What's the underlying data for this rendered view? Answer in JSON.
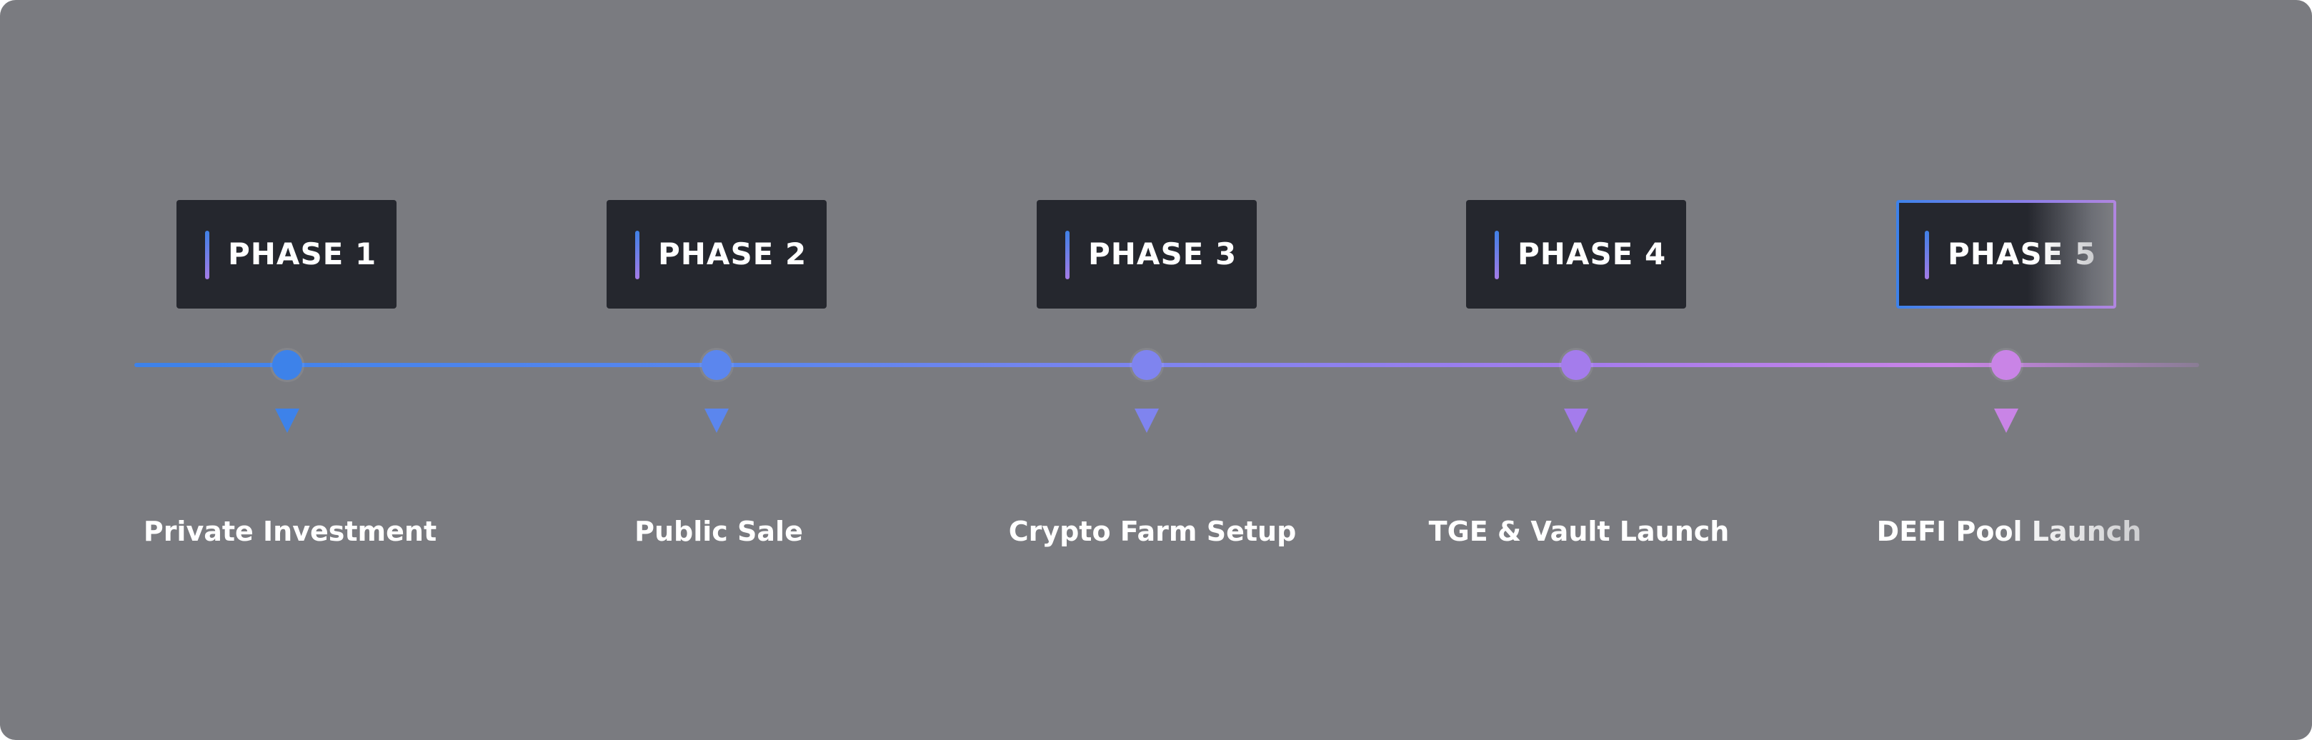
{
  "roadmap": {
    "phases": [
      {
        "label": "PHASE 1",
        "name": "Private Investment",
        "color": "#3d82ea"
      },
      {
        "label": "PHASE 2",
        "name": "Public Sale",
        "color": "#5b86ee"
      },
      {
        "label": "PHASE 3",
        "name": "Crypto Farm Setup",
        "color": "#7f84ef"
      },
      {
        "label": "PHASE 4",
        "name": "TGE & Vault Launch",
        "color": "#a47cec"
      },
      {
        "label": "PHASE 5",
        "name": "DEFI Pool Launch",
        "color": "#c984e6"
      }
    ],
    "active_phase": "PHASE 5"
  },
  "colors": {
    "background": "#7a7b80",
    "card": "#25272e",
    "accent_start": "#3d82ea",
    "accent_end": "#c984e6",
    "text": "#ffffff"
  }
}
